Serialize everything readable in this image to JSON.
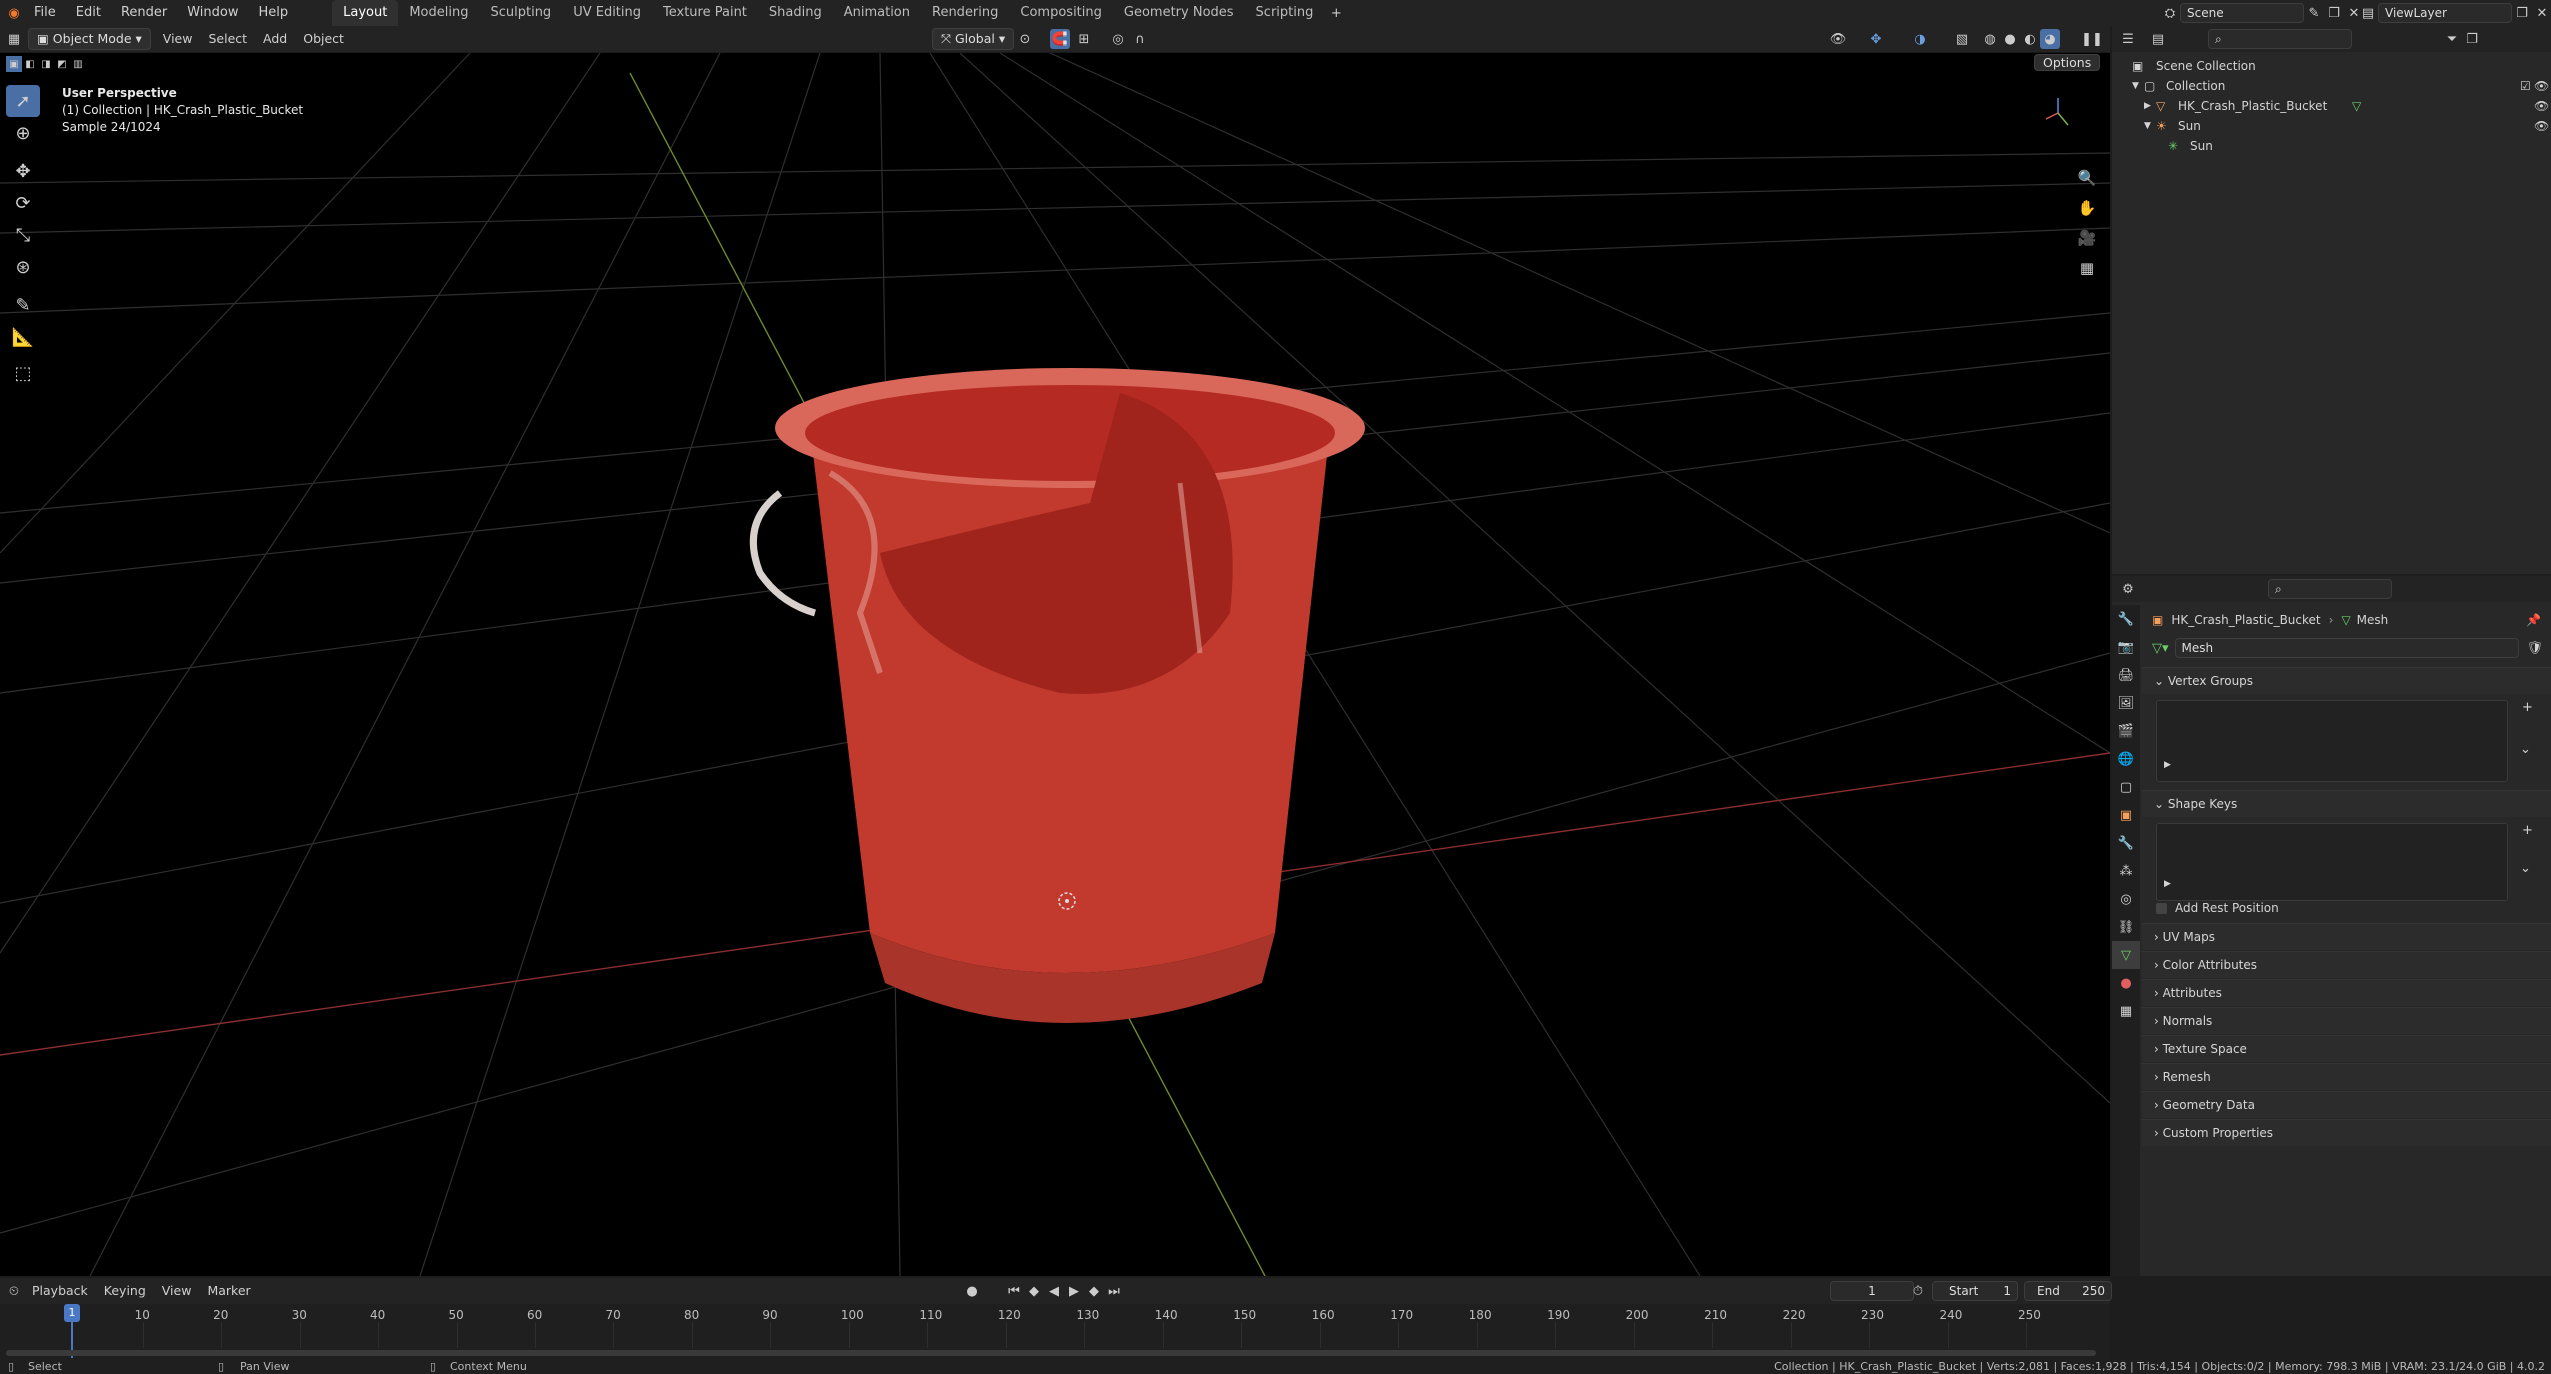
{
  "topbar": {
    "menus": [
      "File",
      "Edit",
      "Render",
      "Window",
      "Help"
    ],
    "workspaces": [
      "Layout",
      "Modeling",
      "Sculpting",
      "UV Editing",
      "Texture Paint",
      "Shading",
      "Animation",
      "Rendering",
      "Compositing",
      "Geometry Nodes",
      "Scripting"
    ],
    "active_workspace": "Layout",
    "scene": "Scene",
    "view_layer": "ViewLayer"
  },
  "header": {
    "mode": "Object Mode",
    "menus": [
      "View",
      "Select",
      "Add",
      "Object"
    ],
    "transform_orientation": "Global",
    "options": "Options"
  },
  "viewport": {
    "overlay_lines": [
      "User Perspective",
      "(1) Collection | HK_Crash_Plastic_Bucket",
      "Sample 24/1024"
    ]
  },
  "outliner": {
    "root": "Scene Collection",
    "collection": "Collection",
    "object1": "HK_Crash_Plastic_Bucket",
    "object2": "Sun",
    "object2_child": "Sun"
  },
  "properties": {
    "object": "HK_Crash_Plastic_Bucket",
    "data": "Mesh",
    "mesh_name": "Mesh",
    "panels_open": [
      "Vertex Groups",
      "Shape Keys"
    ],
    "add_rest_position": "Add Rest Position",
    "panels_closed": [
      "UV Maps",
      "Color Attributes",
      "Attributes",
      "Normals",
      "Texture Space",
      "Remesh",
      "Geometry Data",
      "Custom Properties"
    ]
  },
  "timeline": {
    "menus": [
      "Playback",
      "Keying",
      "View",
      "Marker"
    ],
    "current_frame": "1",
    "start_label": "Start",
    "start": "1",
    "end_label": "End",
    "end": "250",
    "ticks": [
      "1",
      "10",
      "20",
      "30",
      "40",
      "50",
      "60",
      "70",
      "80",
      "90",
      "100",
      "110",
      "120",
      "130",
      "140",
      "150",
      "160",
      "170",
      "180",
      "190",
      "200",
      "210",
      "220",
      "230",
      "240",
      "250"
    ]
  },
  "statusbar": {
    "left": "Select",
    "middle": "Pan View",
    "right_action": "Context Menu",
    "stats": "Collection | HK_Crash_Plastic_Bucket | Verts:2,081 | Faces:1,928 | Tris:4,154 | Objects:0/2 | Memory: 798.3 MiB | VRAM: 23.1/24.0 GiB | 4.0.2"
  },
  "colors": {
    "accent": "#4a6fa5",
    "bucket": "#c0392b"
  }
}
